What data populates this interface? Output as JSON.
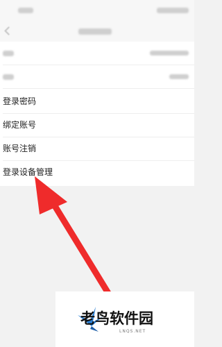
{
  "menu": {
    "items": [
      {
        "label": "登录密码"
      },
      {
        "label": "绑定账号"
      },
      {
        "label": "账号注销"
      },
      {
        "label": "登录设备管理"
      }
    ]
  },
  "watermark": {
    "brand": "老鸟软件园",
    "domain": "LNQS.NET"
  },
  "colors": {
    "arrow": "#ef2b2b",
    "page_background": "#f2f2f2",
    "list_background": "#ffffff"
  }
}
